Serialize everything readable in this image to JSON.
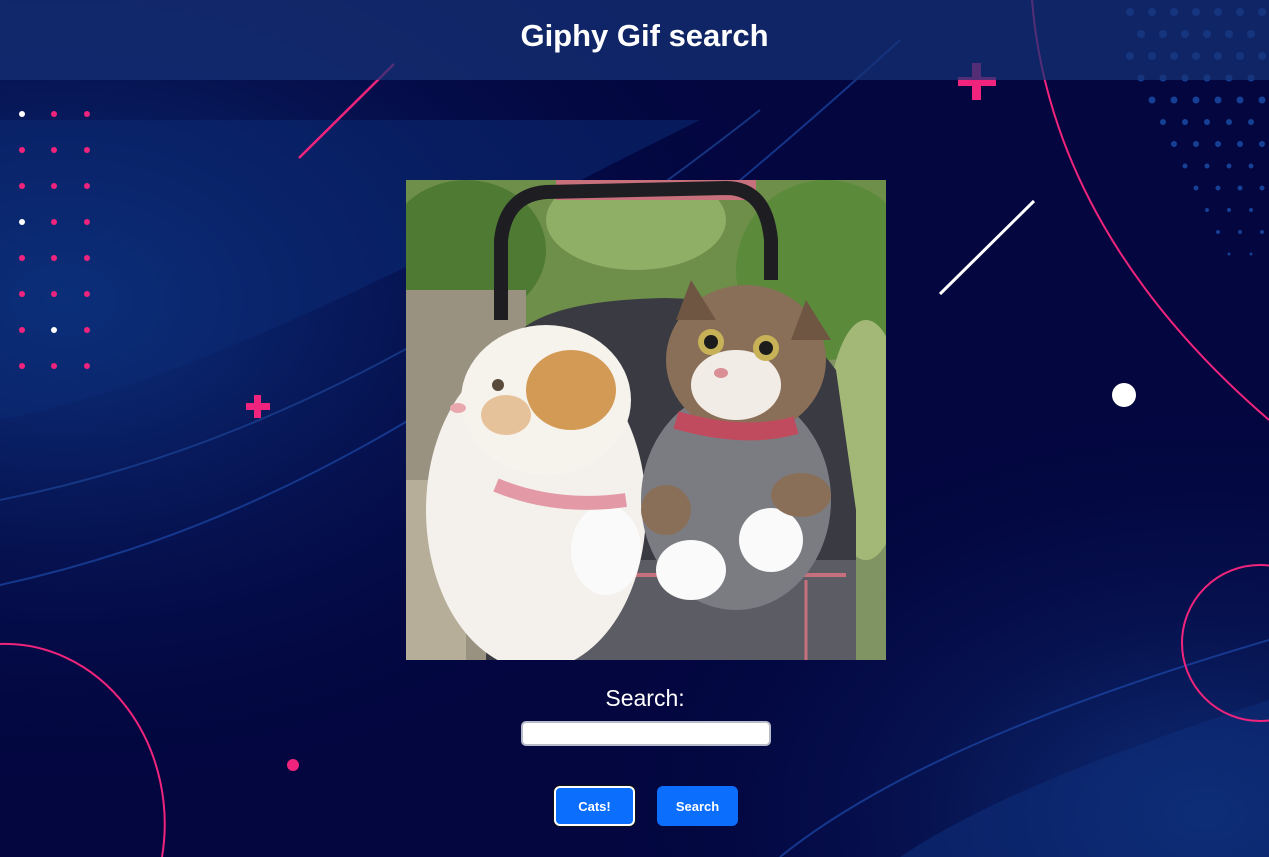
{
  "header": {
    "title": "Giphy Gif search"
  },
  "gif": {
    "description_icon": "image-icon"
  },
  "search": {
    "label": "Search:",
    "value": "",
    "placeholder": ""
  },
  "buttons": {
    "cats_label": "Cats!",
    "search_label": "Search"
  },
  "colors": {
    "background": "#03063f",
    "header": "#163276",
    "accent_pink": "#f0247c",
    "button_blue": "#0b6efd"
  }
}
